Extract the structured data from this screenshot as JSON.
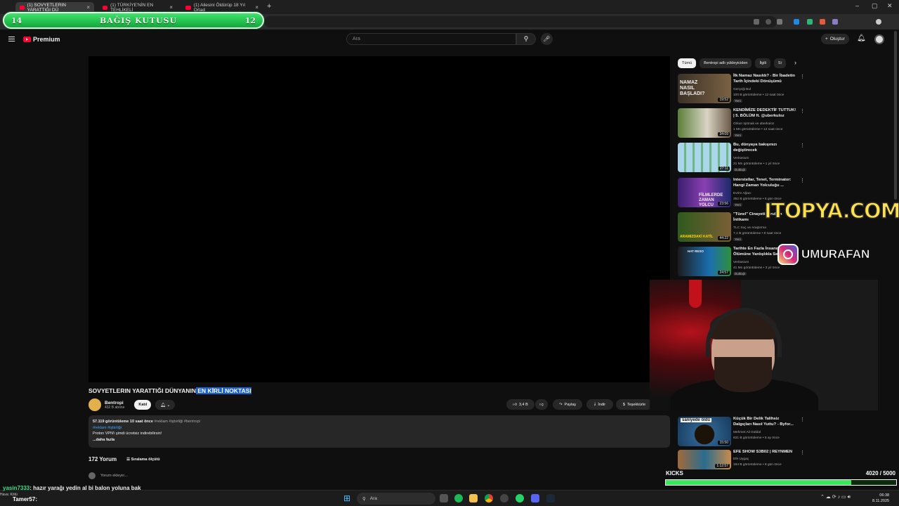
{
  "browser": {
    "tabs": [
      {
        "label": "(1) SOVYETLERIN YARATTIĞI DÜ"
      },
      {
        "label": "(1) TÜRKİYE'NİN EN TEHLİKELİ"
      },
      {
        "label": "(1) Ailesini Öldürüp 18 Yıl Ortad"
      }
    ],
    "new_tab": "+",
    "window_controls": {
      "minimize": "–",
      "maximize": "▢",
      "close": "✕"
    }
  },
  "overlay": {
    "donation_title": "BAĞIŞ KUTUSU",
    "donation_left": "14",
    "donation_right": "12",
    "sponsor": "ITOPYA.COM",
    "instagram_handle": "UMURAFAN",
    "kicks_label": "KICKS",
    "kicks_count": "4020",
    "kicks_total": "/ 5000",
    "kicks_progress": 0.804
  },
  "youtube": {
    "logo": "Premium",
    "search_placeholder": "Ara",
    "create_label": "Oluştur",
    "video_title_plain": "SOVYETLERIN YARATTIĞI DÜNYANIN",
    "video_title_highlight": " EN KİRLİ NOKTASI",
    "channel_name": "Bentropi",
    "channel_subs": "432 B abone",
    "join_label": "Katıl",
    "likes": "3,4 B",
    "share": "Paylaş",
    "download": "İndir",
    "thanks": "Teşekkürle",
    "desc_stats": "57.119 görüntüleme  10 saat önce",
    "desc_tags_inline": "#reklam #işbirliği #bentropi",
    "desc_tags": "#reklam  #işbirliği",
    "desc_line": "Proton VPN'i şimdi ücretsiz indirebilirsin!",
    "desc_more": "...daha fazla",
    "comments_count": "172 Yorum",
    "sort_label": "Sıralama ölçütü",
    "add_comment": "Yorum ekleyin..."
  },
  "chips": [
    {
      "label": "Tümü",
      "active": true
    },
    {
      "label": "Bentropi adlı yükleyiciden",
      "active": false
    },
    {
      "label": "İlgili",
      "active": false
    },
    {
      "label": "Si",
      "active": false
    }
  ],
  "recommendations": [
    {
      "title": "İlk Namaz Nasıldı? - Bir İbadetin Tarih İçindeki Dönüşümü",
      "channel": "Gerçeği Bul",
      "meta": "100 B görüntüleme • 12 saat önce",
      "badge": "Yeni",
      "duration": "19:52",
      "thumb_text": "NAMAZ NASIL BAŞLADI?"
    },
    {
      "title": "KENDİMİZE DEDEKTİF TUTTUK! | 5. BÖLÜM ft. @uberkuloz",
      "channel": "Orkun Işıtmak ve uberkuloz",
      "meta": "1 Mn görüntüleme • 13 saat önce",
      "badge": "Yeni",
      "duration": "34:09",
      "thumb_text": ""
    },
    {
      "title": "Bu, dünyaya bakışınızı değiştirecek",
      "channel": "Veritasium",
      "meta": "21 Mn görüntüleme • 1 yıl önce",
      "badge": "Dublajlı",
      "duration": "27:11",
      "thumb_text": ""
    },
    {
      "title": "Interstellar, Tenet, Terminator: Hangi Zaman Yolculuğu ...",
      "channel": "Evrim Ağacı",
      "meta": "352 B görüntüleme • 6 gün önce",
      "badge": "Yeni",
      "duration": "23:56",
      "thumb_text": "FİLMLERDE ZAMAN YOLCU"
    },
    {
      "title": "\"Tünel\" Cinayeti: Grubun İntikamı",
      "channel": "TLC Suç ve Araştırma",
      "meta": "7,1 B görüntüleme • 8 saat önce",
      "badge": "Yeni",
      "duration": "44:22",
      "thumb_text": "ARAMIZDAKİ KATİL"
    },
    {
      "title": "Tarihte En Fazla İnsanın Ölümüne Yanlışlıkla Se",
      "channel": "Veritasium",
      "meta": "41 Mn görüntüleme • 3 yıl önce",
      "badge": "Dublajlı",
      "duration": "24:57",
      "thumb_text": "HAT RESO"
    },
    {
      "title": "Küçük Bir Delik Talihsiz Dalgıçları Nasıl Yuttu? - Byfor...",
      "channel": "Mehmet Ali Güldal",
      "meta": "631 B görüntüleme • 5 ay önce",
      "badge": "",
      "duration": "15:50",
      "thumb_text": "saniyede öldü"
    },
    {
      "title": "EFE SHOW S3B02 | REYNMEN",
      "channel": "Efe Uygaç",
      "meta": "194 B görüntüleme • 8 gün önce",
      "badge": "",
      "duration": "1:12:57",
      "thumb_text": ""
    }
  ],
  "chat": {
    "user": "yasin7333",
    "message": ": hazır yarağı yedin al bi balon yoluna bak",
    "user2": "Tamer57",
    "message2": ":"
  },
  "taskbar": {
    "weather": "Hava: Kötü",
    "search": "Ara",
    "time": "06:38",
    "date": "8.11.2025"
  },
  "colors": {
    "background": "#0f0f0f",
    "youtube_red": "#ff0033",
    "donation_green": "#2ccb55",
    "sponsor_yellow": "#ffe14d",
    "highlight_blue": "#1a5fd0"
  }
}
